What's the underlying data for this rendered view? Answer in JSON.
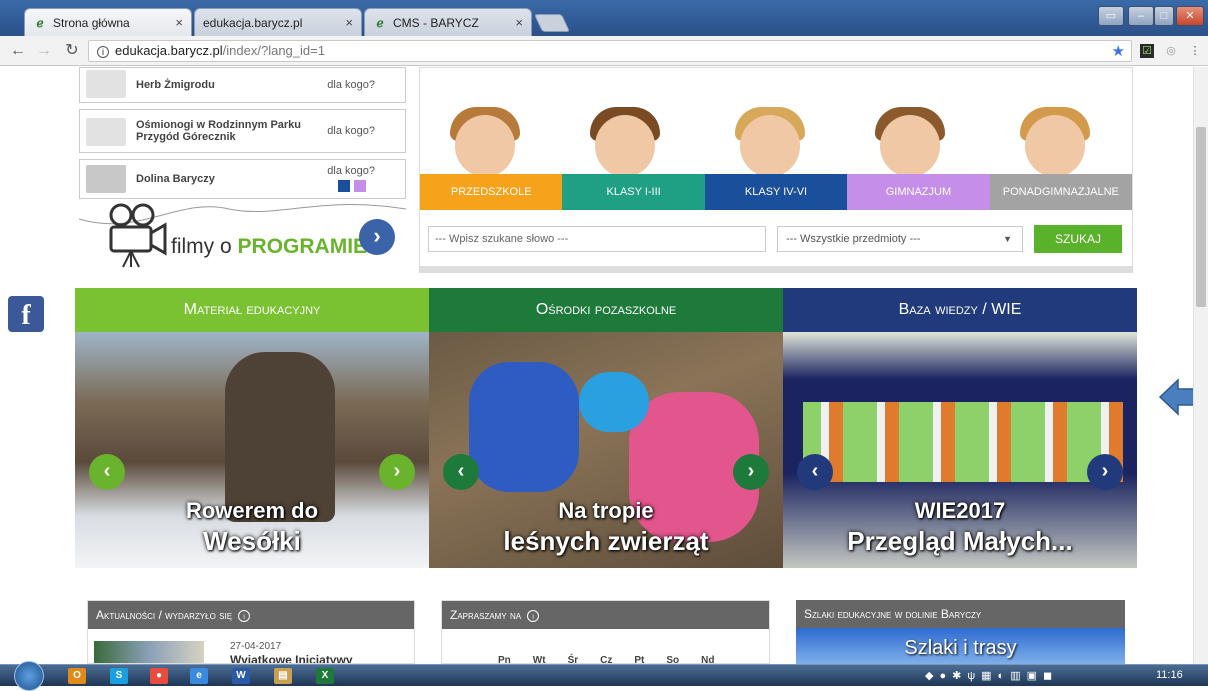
{
  "browser": {
    "tabs": [
      {
        "title": "Strona główna",
        "close": "×"
      },
      {
        "title": "edukacja.barycz.pl",
        "close": "×"
      },
      {
        "title": "CMS - BARYCZ",
        "close": "×"
      }
    ],
    "url_host": "edukacja.barycz.pl",
    "url_path": "/index/?lang_id=1"
  },
  "left": {
    "programs": [
      {
        "name": "Herb Żmigrodu",
        "for_who": "dla kogo?"
      },
      {
        "name": "Ośmionogi w Rodzinnym Parku Przygód Górecznik",
        "for_who": "dla kogo?"
      },
      {
        "name": "Dolina Baryczy",
        "for_who": "dla kogo?"
      }
    ],
    "films_prefix": "filmy o",
    "films_strong": "PROGRAMIE"
  },
  "levels": [
    {
      "label": "PRZEDSZKOLE",
      "color": "#f7a21b"
    },
    {
      "label": "KLASY I-III",
      "color": "#1fa085"
    },
    {
      "label": "KLASY IV-VI",
      "color": "#1a4f9c"
    },
    {
      "label": "GIMNAZJUM",
      "color": "#c58ee8"
    },
    {
      "label": "PONADGIMNAZJALNE",
      "color": "#a3a3a3"
    }
  ],
  "search": {
    "placeholder": "--- Wpisz szukane słowo ---",
    "subject": "--- Wszystkie przedmioty ---",
    "button": "SZUKAJ"
  },
  "panels": [
    {
      "title": "Materiał edukacyjny",
      "header_color": "#7ac231",
      "caption1": "Rowerem do",
      "caption2": "Wesółki"
    },
    {
      "title": "Ośrodki pozaszkolne",
      "header_color": "#1e7a3a",
      "caption1": "Na tropie",
      "caption2": "leśnych zwierząt"
    },
    {
      "title": "Baza wiedzy / WIE",
      "header_color": "#203a7c",
      "caption1": "WIE2017",
      "caption2": "Przegląd Małych..."
    }
  ],
  "boxes": {
    "news_title": "Aktualności / wydarzyło się",
    "news_date": "27-04-2017",
    "news_headline": "Wyjatkowe Inicjatywy",
    "invite_title": "Zapraszamy na",
    "weekdays": [
      "Pn",
      "Wt",
      "Śr",
      "Cz",
      "Pt",
      "So",
      "Nd"
    ],
    "trails_title": "Szlaki edukacyjne w dolinie Baryczy",
    "trails_caption": "Szlaki i trasy"
  },
  "taskbar": {
    "clock": "11:16"
  }
}
